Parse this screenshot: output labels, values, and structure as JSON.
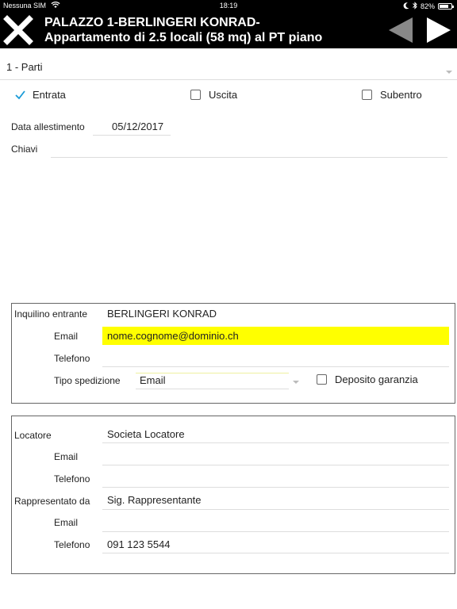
{
  "status_bar": {
    "carrier": "Nessuna SIM",
    "time": "18:19",
    "battery": "82%",
    "battery_level": 0.82
  },
  "header": {
    "title_line1": "PALAZZO 1-BERLINGERI KONRAD-",
    "title_line2": "Appartamento  di 2.5 locali (58 mq) al PT piano"
  },
  "parti_select": {
    "value": "1 - Parti"
  },
  "movement_options": [
    {
      "label": "Entrata",
      "checked": true
    },
    {
      "label": "Uscita",
      "checked": false
    },
    {
      "label": "Subentro",
      "checked": false
    }
  ],
  "form": {
    "data_allestimento_label": "Data allestimento",
    "data_allestimento_value": "05/12/2017",
    "chiavi_label": "Chiavi",
    "chiavi_value": ""
  },
  "inquilino": {
    "label": "Inquilino entrante",
    "name": "BERLINGERI KONRAD",
    "email_label": "Email",
    "email_value": "nome.cognome@dominio.ch",
    "telefono_label": "Telefono",
    "telefono_value": "",
    "tipo_spedizione_label": "Tipo spedizione",
    "tipo_spedizione_value": "Email",
    "deposito_label": "Deposito garanzia",
    "deposito_checked": false
  },
  "locatore": {
    "label": "Locatore",
    "name": "Societa Locatore",
    "email_label": "Email",
    "email_value": "",
    "telefono_label": "Telefono",
    "telefono_value": "",
    "rappresentato_label": "Rappresentato da",
    "rappresentato_value": "Sig. Rappresentante",
    "rap_email_label": "Email",
    "rap_email_value": "",
    "rap_telefono_label": "Telefono",
    "rap_telefono_value": "091 123 5544"
  },
  "colors": {
    "accent_check": "#1a9bd7",
    "highlight": "#ffff00",
    "nav_disabled": "#888888"
  },
  "icons": {
    "close": "close-icon",
    "prev": "arrow-left-icon",
    "next": "arrow-right-icon",
    "wifi": "wifi-icon",
    "bluetooth": "bluetooth-icon",
    "moon": "moon-icon",
    "battery": "battery-icon"
  }
}
